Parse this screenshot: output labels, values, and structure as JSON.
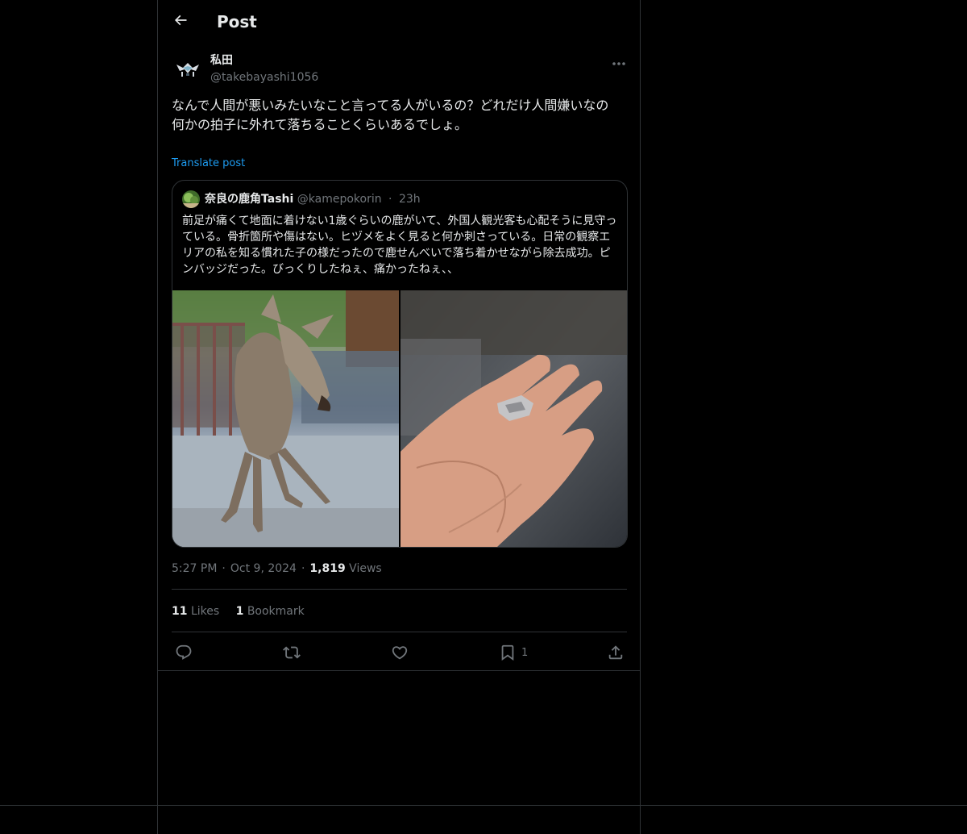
{
  "header": {
    "title": "Post"
  },
  "author": {
    "name": "私田",
    "handle": "@takebayashi1056"
  },
  "post": {
    "lines": [
      "なんで人間が悪いみたいなこと言ってる人がいるの？どれだけ人間嫌いなの",
      "何かの拍子に外れて落ちることくらいあるでしょ。"
    ],
    "translate_label": "Translate post"
  },
  "quote": {
    "name": "奈良の鹿角Tashi",
    "handle": "@kamepokorin",
    "dot": "·",
    "time": "23h",
    "text": "前足が痛くて地面に着けない1歳ぐらいの鹿がいて、外国人観光客も心配そうに見守っている。骨折箇所や傷はない。ヒヅメをよく見ると何か刺さっている。日常の観察エリアの私を知る慣れた子の様だったので鹿せんべいで落ち着かせながら除去成功。ピンバッジだった。びっくりしたねぇ、痛かったねぇ、、"
  },
  "meta": {
    "time": "5:27 PM",
    "dot1": "·",
    "date": "Oct 9, 2024",
    "dot2": "·",
    "views_count": "1,819",
    "views_label": "Views"
  },
  "stats": {
    "likes_count": "11",
    "likes_label": "Likes",
    "bookmarks_count": "1",
    "bookmarks_label": "Bookmark"
  },
  "actions": {
    "bookmark_count": "1"
  },
  "icons": {
    "back": "arrow-left-icon",
    "more": "more-horizontal-icon",
    "reply": "reply-icon",
    "repost": "repost-icon",
    "like": "heart-icon",
    "bookmark": "bookmark-icon",
    "share": "share-icon"
  },
  "colors": {
    "background": "#000000",
    "text": "#e7e9ea",
    "secondary": "#71767b",
    "link": "#1d9bf0",
    "border": "#2f3336"
  }
}
